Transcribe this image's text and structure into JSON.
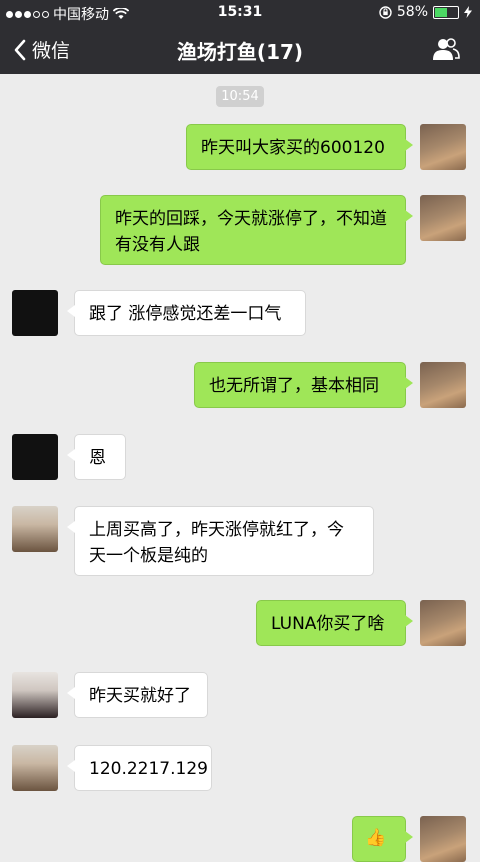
{
  "status_bar": {
    "carrier": "中国移动",
    "time": "15:31",
    "battery_percent": "58%",
    "battery_level": 0.58
  },
  "nav": {
    "back_label": "微信",
    "title": "渔场打鱼(17)"
  },
  "chat": {
    "timestamp": "10:54",
    "messages": [
      {
        "side": "out",
        "text": "昨天叫大家买的600120"
      },
      {
        "side": "out",
        "text": "昨天的回踩，今天就涨停了，不知道有没有人跟"
      },
      {
        "side": "in",
        "text": "跟了 涨停感觉还差一口气"
      },
      {
        "side": "out",
        "text": "也无所谓了，基本相同"
      },
      {
        "side": "in",
        "text": "恩"
      },
      {
        "side": "in",
        "text": "上周买高了，昨天涨停就红了，今天一个板是纯的"
      },
      {
        "side": "out",
        "text": "LUNA你买了啥"
      },
      {
        "side": "in",
        "text": "昨天买就好了"
      },
      {
        "side": "in",
        "text": "120.2217.129"
      },
      {
        "side": "out",
        "text": "👍"
      }
    ]
  },
  "colors": {
    "nav_bg": "#2e2e32",
    "chat_bg": "#ececec",
    "outgoing_bubble": "#9fe658",
    "incoming_bubble": "#ffffff"
  }
}
